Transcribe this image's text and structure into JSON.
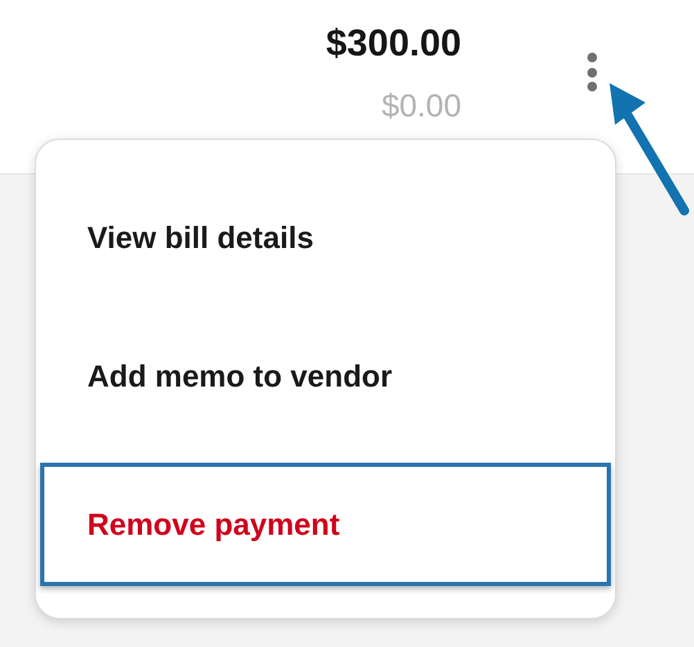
{
  "amount": "$300.00",
  "amount_secondary": "$0.00",
  "menu": {
    "items": [
      {
        "label": "View bill details",
        "danger": false,
        "highlighted": false
      },
      {
        "label": "Add memo to vendor",
        "danger": false,
        "highlighted": false
      },
      {
        "label": "Remove payment",
        "danger": true,
        "highlighted": true
      }
    ]
  }
}
